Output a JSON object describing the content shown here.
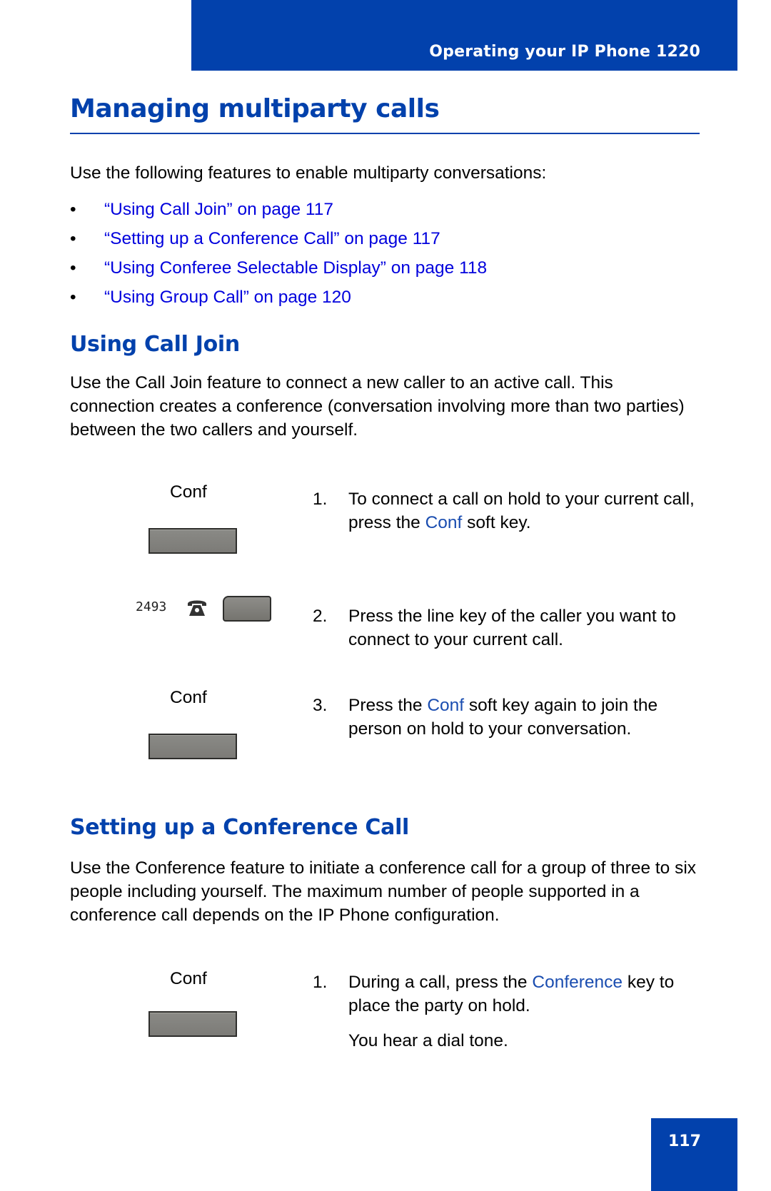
{
  "header": {
    "running_title": "Operating your IP Phone 1220",
    "accent_color": "#0241ac"
  },
  "page_title": "Managing multiparty calls",
  "intro": "Use the following features to enable multiparty conversations:",
  "bullet_glyph": "•",
  "cross_references": [
    {
      "label": "“Using Call Join” on page 117"
    },
    {
      "label": "“Setting up a Conference Call” on page 117"
    },
    {
      "label": "“Using Conferee Selectable Display” on page 118"
    },
    {
      "label": "“Using Group Call” on page 120"
    }
  ],
  "sections": [
    {
      "heading": "Using Call Join",
      "body": "Use the Call Join feature to connect a new caller to an active call. This connection creates a conference (conversation involving more than two parties) between the two callers and yourself.",
      "line_key": {
        "number": "2493",
        "icon": "telephone-icon"
      },
      "steps": [
        {
          "num": "1.",
          "pre": "To connect a call on hold to your current call, press the ",
          "kw": "Conf",
          "post": " soft key.",
          "key_label": "Conf"
        },
        {
          "num": "2.",
          "text": "Press the line key of the caller you want to connect to your current call."
        },
        {
          "num": "3.",
          "pre": "Press the ",
          "kw": "Conf",
          "post": " soft key again to join the person on hold to your conversation.",
          "key_label": "Conf"
        }
      ]
    },
    {
      "heading": "Setting up a Conference Call",
      "body": "Use the Conference feature to initiate a conference call for a group of three to six people including yourself. The maximum number of people supported in a conference call depends on the IP Phone configuration.",
      "steps": [
        {
          "num": "1.",
          "pre": "During a call, press the ",
          "kw": "Conference",
          "post": "  key to place the party on hold.",
          "key_label": "Conf",
          "note": "You hear a dial tone."
        }
      ]
    }
  ],
  "footer": {
    "page_number": "117"
  }
}
